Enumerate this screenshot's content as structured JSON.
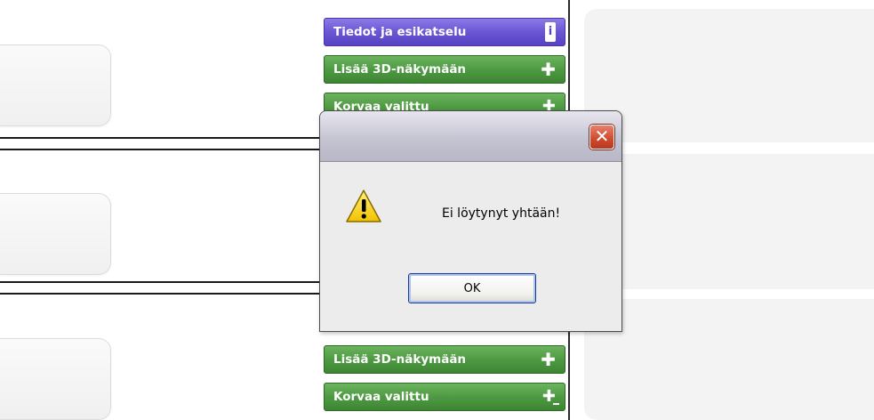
{
  "side_buttons": {
    "info_label": "Tiedot ja esikatselu",
    "add_3d_label": "Lisää 3D-näkymään",
    "replace_label": "Korvaa valittu",
    "info_icon": "i"
  },
  "dialog": {
    "message": "Ei löytynyt yhtään!",
    "ok_label": "OK",
    "close_glyph": "✕"
  },
  "colors": {
    "green_button": "#4e9a42",
    "purple_button": "#6a55d4",
    "dialog_bg": "#ececec",
    "close_red": "#cc4a2f"
  },
  "icons": [
    "info-icon",
    "plus-icon",
    "warning-icon",
    "close-icon"
  ]
}
